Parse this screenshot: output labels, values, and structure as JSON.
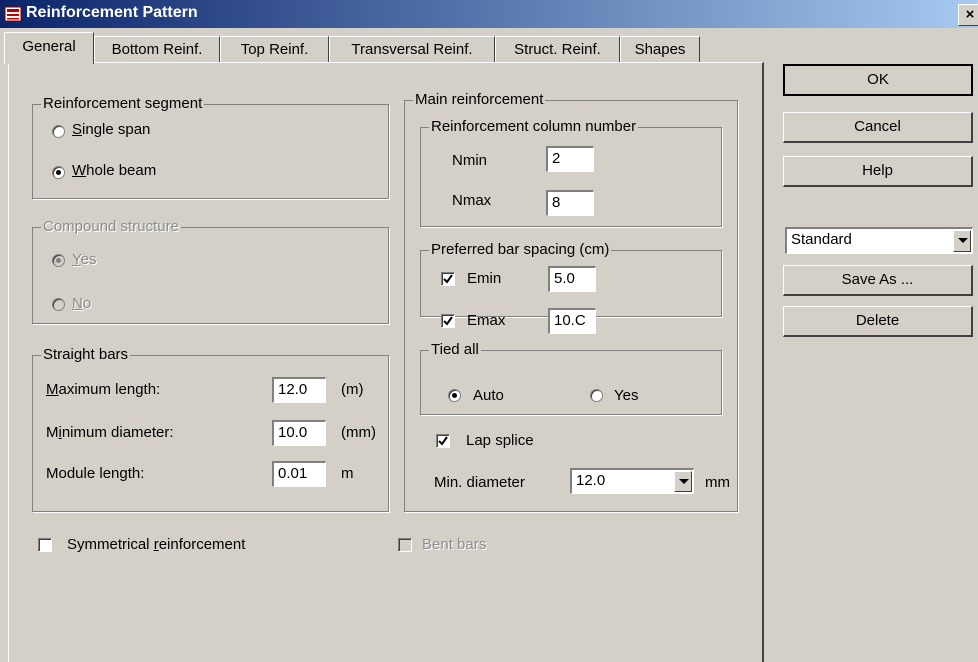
{
  "window": {
    "title": "Reinforcement Pattern",
    "close": "×"
  },
  "tabs": [
    "General",
    "Bottom Reinf.",
    "Top Reinf.",
    "Transversal Reinf.",
    "Struct. Reinf.",
    "Shapes"
  ],
  "segment": {
    "legend": "Reinforcement segment",
    "single": {
      "key": "S",
      "rest": "ingle span",
      "selected": false
    },
    "whole": {
      "key": "W",
      "rest": "hole beam",
      "selected": true
    }
  },
  "compound": {
    "legend": "Compound structure",
    "yes": {
      "key": "Y",
      "rest": "es",
      "selected": true
    },
    "no": {
      "key": "N",
      "rest": "o",
      "selected": false
    },
    "enabled": false
  },
  "straight": {
    "legend": "Straight bars",
    "max_length": {
      "pre": "",
      "key": "M",
      "rest": "aximum length:",
      "value": "12.0",
      "unit": "(m)"
    },
    "min_diameter": {
      "pre": "M",
      "key": "i",
      "rest": "nimum diameter:",
      "value": "10.0",
      "unit": "(mm)"
    },
    "module_length": {
      "label": "Module length:",
      "value": "0.01",
      "unit": "m"
    }
  },
  "main": {
    "legend": "Main reinforcement",
    "column_number": {
      "legend": "Reinforcement column number",
      "nmin_label": "Nmin",
      "nmin": "2",
      "nmax_label": "Nmax",
      "nmax": "8"
    },
    "spacing": {
      "legend": "Preferred bar spacing (cm)",
      "emin_label": "Emin",
      "emin": "5.0",
      "emin_checked": true,
      "emax_label": "Emax",
      "emax": "10.C",
      "emax_checked": true
    },
    "tied": {
      "legend": "Tied all",
      "auto": "Auto",
      "yes": "Yes",
      "selected": "Auto"
    },
    "lap_splice": {
      "label": "Lap splice",
      "checked": true
    },
    "min_diameter": {
      "label": "Min. diameter",
      "value": "12.0",
      "unit": "mm"
    }
  },
  "symmetrical": {
    "pre": "Symmetrical ",
    "key": "r",
    "rest": "einforcement",
    "checked": false
  },
  "bent_bars": {
    "label": "Bent bars",
    "checked": false,
    "enabled": false
  },
  "buttons": {
    "ok": "OK",
    "cancel": "Cancel",
    "help": "Help",
    "save_as": "Save As ...",
    "delete": "Delete"
  },
  "preset": {
    "value": "Standard"
  }
}
